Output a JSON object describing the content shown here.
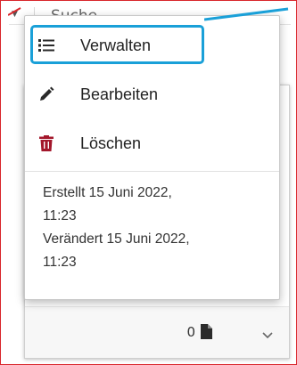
{
  "background": {
    "search_label": "Suche",
    "file_count": "0"
  },
  "menu": {
    "items": [
      {
        "label": "Verwalten",
        "icon": "list-icon"
      },
      {
        "label": "Bearbeiten",
        "icon": "pencil-icon"
      },
      {
        "label": "Löschen",
        "icon": "trash-icon"
      }
    ],
    "created_line1": "Erstellt 15 Juni 2022,",
    "created_line2": "11:23",
    "modified_line1": "Verändert 15 Juni 2022,",
    "modified_line2": "11:23"
  },
  "colors": {
    "highlight": "#1aa0d8",
    "frame": "#d9262b",
    "trash": "#a3172b"
  }
}
